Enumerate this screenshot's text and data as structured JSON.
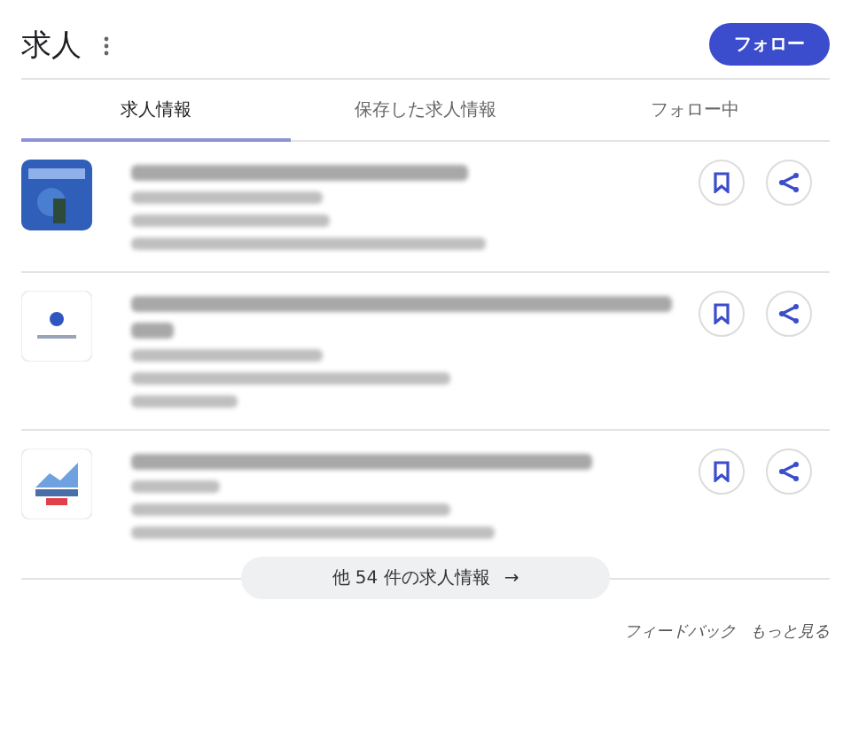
{
  "header": {
    "title": "求人",
    "follow_button": "フォロー"
  },
  "tabs": [
    {
      "label": "求人情報",
      "selected": true
    },
    {
      "label": "保存した求人情報",
      "selected": false
    },
    {
      "label": "フォロー中",
      "selected": false
    }
  ],
  "jobs": [
    {
      "kind": "tile"
    },
    {
      "kind": "dot"
    },
    {
      "kind": "chart"
    }
  ],
  "more_button": {
    "label": "他 54 件の求人情報",
    "arrow": "→"
  },
  "footer": {
    "links": [
      "フィードバック",
      "もっと見る"
    ]
  }
}
